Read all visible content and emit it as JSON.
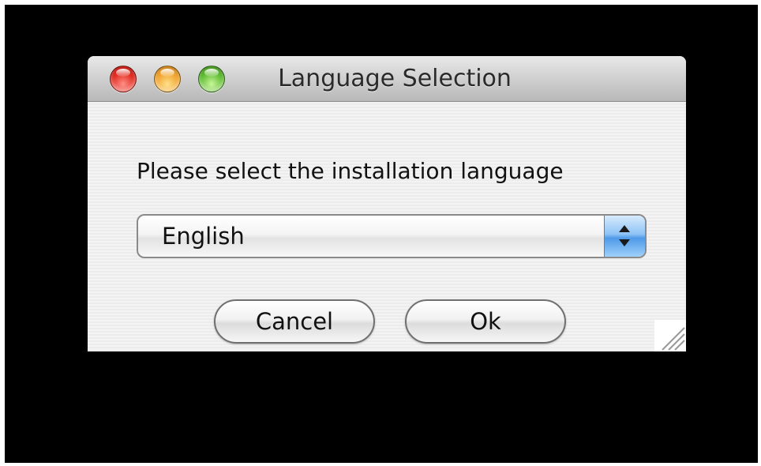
{
  "window": {
    "title": "Language Selection"
  },
  "dialog": {
    "prompt": "Please select the installation language",
    "language_select": {
      "selected": "English"
    },
    "buttons": {
      "cancel_label": "Cancel",
      "ok_label": "Ok"
    }
  },
  "icons": {
    "close": "close-light-icon",
    "minimize": "minimize-light-icon",
    "zoom": "zoom-light-icon",
    "popup_arrows": "updown-arrows-icon",
    "resize_grip": "resize-grip-icon"
  },
  "colors": {
    "backdrop": "#000000",
    "window_bg": "#ececec",
    "close": "#e0281d",
    "minimize": "#f0a12a",
    "zoom": "#5cba2f",
    "popup_accent": "#4f9ae8"
  }
}
